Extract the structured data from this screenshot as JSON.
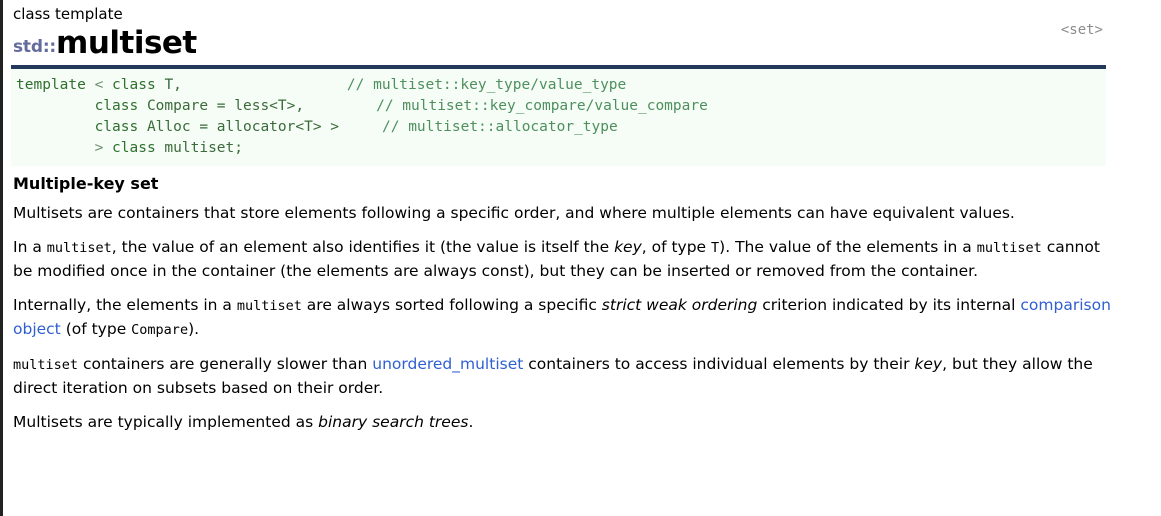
{
  "header": {
    "eyebrow": "class template",
    "namespace": "std::",
    "name": "multiset",
    "include": "<set>"
  },
  "code": {
    "lines": [
      {
        "segments": [
          {
            "text": "template ",
            "style": "kw"
          },
          {
            "text": "< ",
            "style": "punc"
          },
          {
            "text": "class ",
            "style": "kw"
          },
          {
            "text": "T,",
            "style": "id"
          }
        ],
        "comment": "// multiset::key_type/value_type"
      },
      {
        "segments": [
          {
            "text": "         class ",
            "style": "kw"
          },
          {
            "text": "Compare = less<T>,",
            "style": "id"
          }
        ],
        "comment": "// multiset::key_compare/value_compare"
      },
      {
        "segments": [
          {
            "text": "         class ",
            "style": "kw"
          },
          {
            "text": "Alloc = allocator<T> >",
            "style": "id"
          }
        ],
        "comment": "// multiset::allocator_type"
      },
      {
        "segments": [
          {
            "text": "         > ",
            "style": "punc"
          },
          {
            "text": "class ",
            "style": "kw"
          },
          {
            "text": "multiset;",
            "style": "id"
          }
        ],
        "comment": ""
      }
    ]
  },
  "body": {
    "section_title": "Multiple-key set",
    "p1_a": "Multisets are containers that store elements following a specific order, and where multiple elements can have equivalent values.",
    "p2_a": "In a ",
    "p2_code1": "multiset",
    "p2_b": ", the value of an element also identifies it (the value is itself the ",
    "p2_em1": "key",
    "p2_c": ", of type ",
    "p2_code2": "T",
    "p2_d": "). The value of the elements in a ",
    "p2_code3": "multiset",
    "p2_e": " cannot be modified once in the container (the elements are always const), but they can be inserted or removed from the container.",
    "p3_a": "Internally, the elements in a ",
    "p3_code1": "multiset",
    "p3_b": " are always sorted following a specific ",
    "p3_em1": "strict weak ordering",
    "p3_c": " criterion indicated by its internal ",
    "p3_link1": "comparison object",
    "p3_d": " (of type ",
    "p3_code2": "Compare",
    "p3_e": ").",
    "p4_code1": "multiset",
    "p4_a": " containers are generally slower than ",
    "p4_link1": "unordered_multiset",
    "p4_b": " containers to access individual elements by their ",
    "p4_em1": "key",
    "p4_c": ", but they allow the direct iteration on subsets based on their order.",
    "p5_a": "Multisets are typically implemented as ",
    "p5_em1": "binary search trees",
    "p5_b": "."
  },
  "colors": {
    "rule": "#23395b",
    "namespace": "#636c9c",
    "code_background": "#f6fdf6",
    "code_text": "#3b6a3b",
    "comment": "#4e8f5e",
    "link": "#2f5fd0"
  }
}
